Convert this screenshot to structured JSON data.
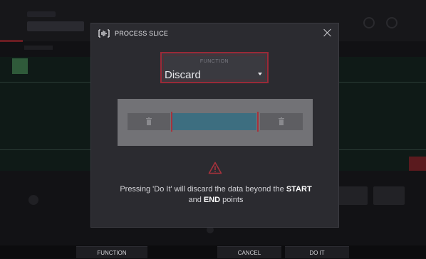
{
  "modal": {
    "title": "PROCESS SLICE",
    "function_label": "FUNCTION",
    "function_value": "Discard",
    "warning_pre": "Pressing 'Do It' will discard the data beyond the ",
    "warning_start": "START",
    "warning_mid": " and ",
    "warning_end": "END",
    "warning_post": " points"
  },
  "softkeys": {
    "function": "FUNCTION",
    "cancel": "CANCEL",
    "do_it": "DO IT"
  },
  "icons": {
    "header": "slice-waveform-icon",
    "close": "close-icon",
    "segments": "trash-icon",
    "warning": "warning-triangle-icon"
  },
  "colors": {
    "accent_red": "#9a2a38",
    "segment_kept": "#3d6e80",
    "segment_discarded": "#5e5e62",
    "warning": "#a8323c"
  }
}
